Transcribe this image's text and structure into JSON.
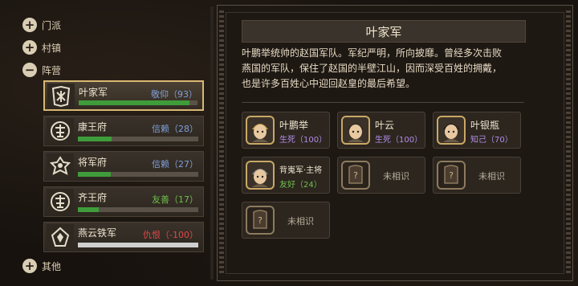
{
  "categories": {
    "sect": "门派",
    "town": "村镇",
    "camp": "阵营",
    "other": "其他"
  },
  "factions": [
    {
      "name": "叶家军",
      "relation": "敬仰（93）",
      "level": 0.93,
      "rel_color": "#7f9fd8",
      "bar_color": "#3f9c3a",
      "emblem": "ye-clan-emblem-icon",
      "selected": true
    },
    {
      "name": "康王府",
      "relation": "信赖（28）",
      "level": 0.28,
      "rel_color": "#7f9fd8",
      "bar_color": "#3f9c3a",
      "emblem": "kang-palace-emblem-icon",
      "selected": false
    },
    {
      "name": "将军府",
      "relation": "信赖（27）",
      "level": 0.27,
      "rel_color": "#7f9fd8",
      "bar_color": "#3f9c3a",
      "emblem": "general-mansion-emblem-icon",
      "selected": false
    },
    {
      "name": "齐王府",
      "relation": "友善（17）",
      "level": 0.17,
      "rel_color": "#6fbf4a",
      "bar_color": "#3f9c3a",
      "emblem": "qi-palace-emblem-icon",
      "selected": false
    },
    {
      "name": "燕云铁军",
      "relation": "仇恨（-100）",
      "level": 1.0,
      "rel_color": "#e04848",
      "bar_color": "#cfcfcf",
      "emblem": "yanyun-army-emblem-icon",
      "selected": false
    }
  ],
  "detail": {
    "title": "叶家军",
    "description_lines": [
      "叶鹏举统帅的赵国军队。军纪严明，所向披靡。曾经多次击败",
      "燕国的军队，保住了赵国的半壁江山，因而深受百姓的拥戴，",
      "也是许多百姓心中迎回赵皇的最后希望。"
    ],
    "members": [
      {
        "name": "叶鹏举",
        "relation": "生死（100）",
        "rel_color": "#b58ce8",
        "avatar": "general-ye-pengju-avatar-icon"
      },
      {
        "name": "叶云",
        "relation": "生死（100）",
        "rel_color": "#b58ce8",
        "avatar": "ye-yun-avatar-icon"
      },
      {
        "name": "叶银瓶",
        "relation": "知己（70）",
        "rel_color": "#b58ce8",
        "avatar": "ye-yinping-avatar-icon"
      },
      {
        "name": "背嵬军·主将",
        "relation": "友好（24）",
        "rel_color": "#6fbf4a",
        "avatar": "beiwei-general-avatar-icon"
      },
      {
        "name": "未相识",
        "relation": "",
        "rel_color": "",
        "avatar": "unknown-avatar-icon"
      },
      {
        "name": "未相识",
        "relation": "",
        "rel_color": "",
        "avatar": "unknown-avatar-icon"
      },
      {
        "name": "未相识",
        "relation": "",
        "rel_color": "",
        "avatar": "unknown-avatar-icon"
      }
    ]
  }
}
